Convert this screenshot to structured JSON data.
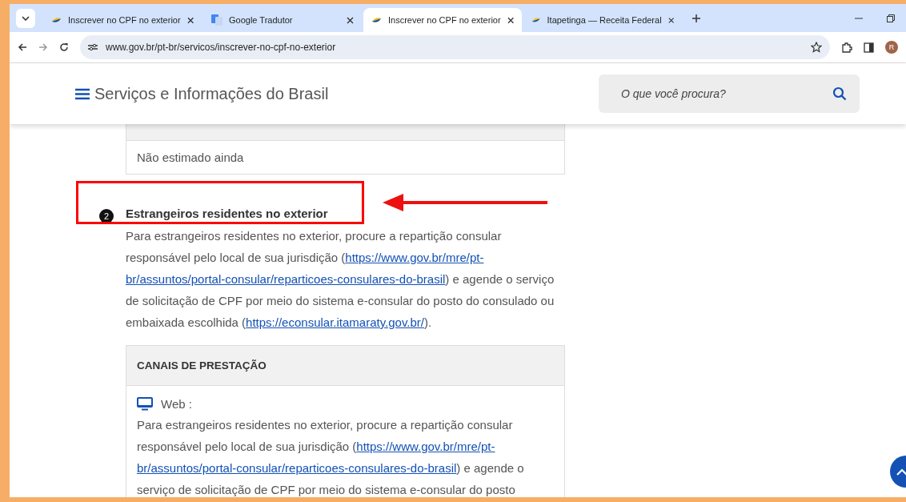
{
  "browser": {
    "tabs": [
      {
        "title": "Inscrever no CPF no exterior",
        "selected": false,
        "kind": "gov"
      },
      {
        "title": "Google Tradutor",
        "selected": false,
        "kind": "translate"
      },
      {
        "title": "Inscrever no CPF no exterior",
        "selected": true,
        "kind": "gov"
      },
      {
        "title": "Itapetinga — Receita Federal",
        "selected": false,
        "kind": "gov"
      }
    ],
    "url": "www.gov.br/pt-br/servicos/inscrever-no-cpf-no-exterior",
    "profile_initial": "R"
  },
  "site_header": {
    "title": "Serviços e Informações do Brasil",
    "search_placeholder": "O que você procura?"
  },
  "duration_table": {
    "value": "Não estimado ainda"
  },
  "section": {
    "step": "2",
    "title": "Estrangeiros residentes no exterior",
    "paragraph": [
      {
        "kind": "text",
        "text": "Para estrangeiros residentes no exterior, procure a repartição consular responsável pelo local de sua jurisdição ("
      },
      {
        "kind": "link",
        "text": "https://www.gov.br/mre/pt-"
      },
      {
        "kind": "link",
        "text": "br/assuntos/portal-consular/reparticoes-consulares-do-brasil"
      },
      {
        "kind": "text",
        "text": ") e agende o serviço de solicitação de CPF por meio do sistema e-consular do posto do consulado ou embaixada escolhida ("
      },
      {
        "kind": "link",
        "text": "https://econsular.itamaraty.gov.br/"
      },
      {
        "kind": "text",
        "text": ")."
      }
    ]
  },
  "channels_card": {
    "title": "CANAIS DE PRESTAÇÃO",
    "channel": {
      "label": "Web :",
      "paragraph": [
        {
          "kind": "text",
          "text": "Para estrangeiros residentes no exterior, procure a repartição consular responsável pelo local de sua jurisdição ("
        },
        {
          "kind": "link",
          "text": "https://www.gov.br/mre/pt-"
        },
        {
          "kind": "link",
          "text": "br/assuntos/portal-consular/reparticoes-consulares-do-brasil"
        },
        {
          "kind": "text",
          "text": ") e agende o serviço de solicitação de CPF por meio do sistema e-consular do posto"
        }
      ]
    }
  }
}
